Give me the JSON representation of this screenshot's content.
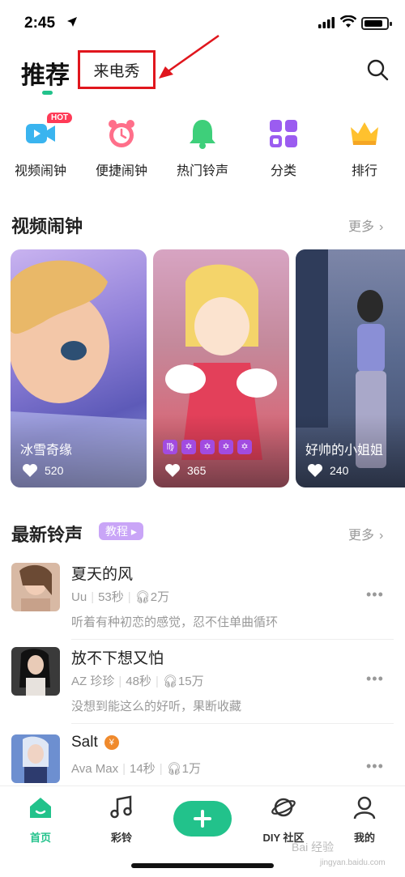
{
  "status_bar": {
    "time": "2:45"
  },
  "header": {
    "tab_recommend": "推荐",
    "tab_callshow": "来电秀",
    "search_icon": "search-icon"
  },
  "quick_actions": [
    {
      "label": "视频闹钟",
      "icon": "video-camera-icon",
      "badge": "HOT"
    },
    {
      "label": "便捷闹钟",
      "icon": "alarm-clock-icon"
    },
    {
      "label": "热门铃声",
      "icon": "bell-icon"
    },
    {
      "label": "分类",
      "icon": "grid-icon"
    },
    {
      "label": "排行",
      "icon": "crown-icon"
    }
  ],
  "video_section": {
    "title": "视频闹钟",
    "more": "更多",
    "cards": [
      {
        "title": "冰雪奇缘",
        "likes": "520"
      },
      {
        "title": "",
        "likes": "365",
        "tags": [
          "♍",
          "✡",
          "✡",
          "✡",
          "✡"
        ]
      },
      {
        "title": "好帅的小姐姐",
        "likes": "240"
      }
    ]
  },
  "ringtone_section": {
    "title": "最新铃声",
    "badge": "教程",
    "more": "更多",
    "items": [
      {
        "title": "夏天的风",
        "artist": "Uu",
        "duration": "53秒",
        "plays": "2万",
        "desc": "听着有种初恋的感觉，忍不住单曲循环"
      },
      {
        "title": "放不下想又怕",
        "artist": "AZ 珍珍",
        "duration": "48秒",
        "plays": "15万",
        "desc": "没想到能这么的好听，果断收藏"
      },
      {
        "title": "Salt",
        "artist": "Ava Max",
        "duration": "14秒",
        "plays": "1万",
        "vip": "¥"
      }
    ]
  },
  "bottom_nav": {
    "items": [
      {
        "label": "首页",
        "icon": "home-icon",
        "active": true
      },
      {
        "label": "彩铃",
        "icon": "music-note-icon"
      },
      {
        "label": "",
        "icon": "plus-icon"
      },
      {
        "label": "DIY 社区",
        "icon": "planet-icon"
      },
      {
        "label": "我的",
        "icon": "user-icon"
      }
    ]
  },
  "watermark": {
    "text": "Bai 经验",
    "sub": "jingyan.baidu.com"
  },
  "colors": {
    "accent": "#22c28b",
    "highlight_box": "#e0161d",
    "tag_purple": "#a24be0",
    "hot_red": "#ff3b57"
  }
}
